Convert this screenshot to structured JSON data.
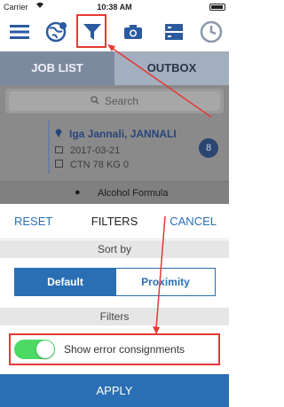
{
  "status_bar": {
    "carrier": "Carrier",
    "time": "10:38 AM"
  },
  "toolbar": {
    "icons": [
      "menu-icon",
      "globe-icon",
      "filter-icon",
      "camera-icon",
      "storage-icon",
      "clock-icon"
    ]
  },
  "tabs": [
    {
      "label": "JOB LIST",
      "active": true
    },
    {
      "label": "OUTBOX",
      "active": false
    }
  ],
  "search": {
    "placeholder": "Search"
  },
  "card": {
    "name": "Iga Jannali, JANNALI",
    "date": "2017-03-21",
    "cargo": "CTN 78 KG 0",
    "badge": "8"
  },
  "card2": {
    "text": "Alcohol Formula"
  },
  "filters": {
    "reset_label": "RESET",
    "title": "FILTERS",
    "cancel_label": "CANCEL",
    "sort_by_label": "Sort by",
    "sort_options": [
      "Default",
      "Proximity"
    ],
    "sort_selected": "Default",
    "filters_label": "Filters",
    "toggle_label": "Show error consignments",
    "toggle_on": true,
    "apply_label": "APPLY"
  },
  "colors": {
    "accent": "#2a6fb3",
    "toggle_on": "#4cd964",
    "annotation": "#e53935"
  }
}
